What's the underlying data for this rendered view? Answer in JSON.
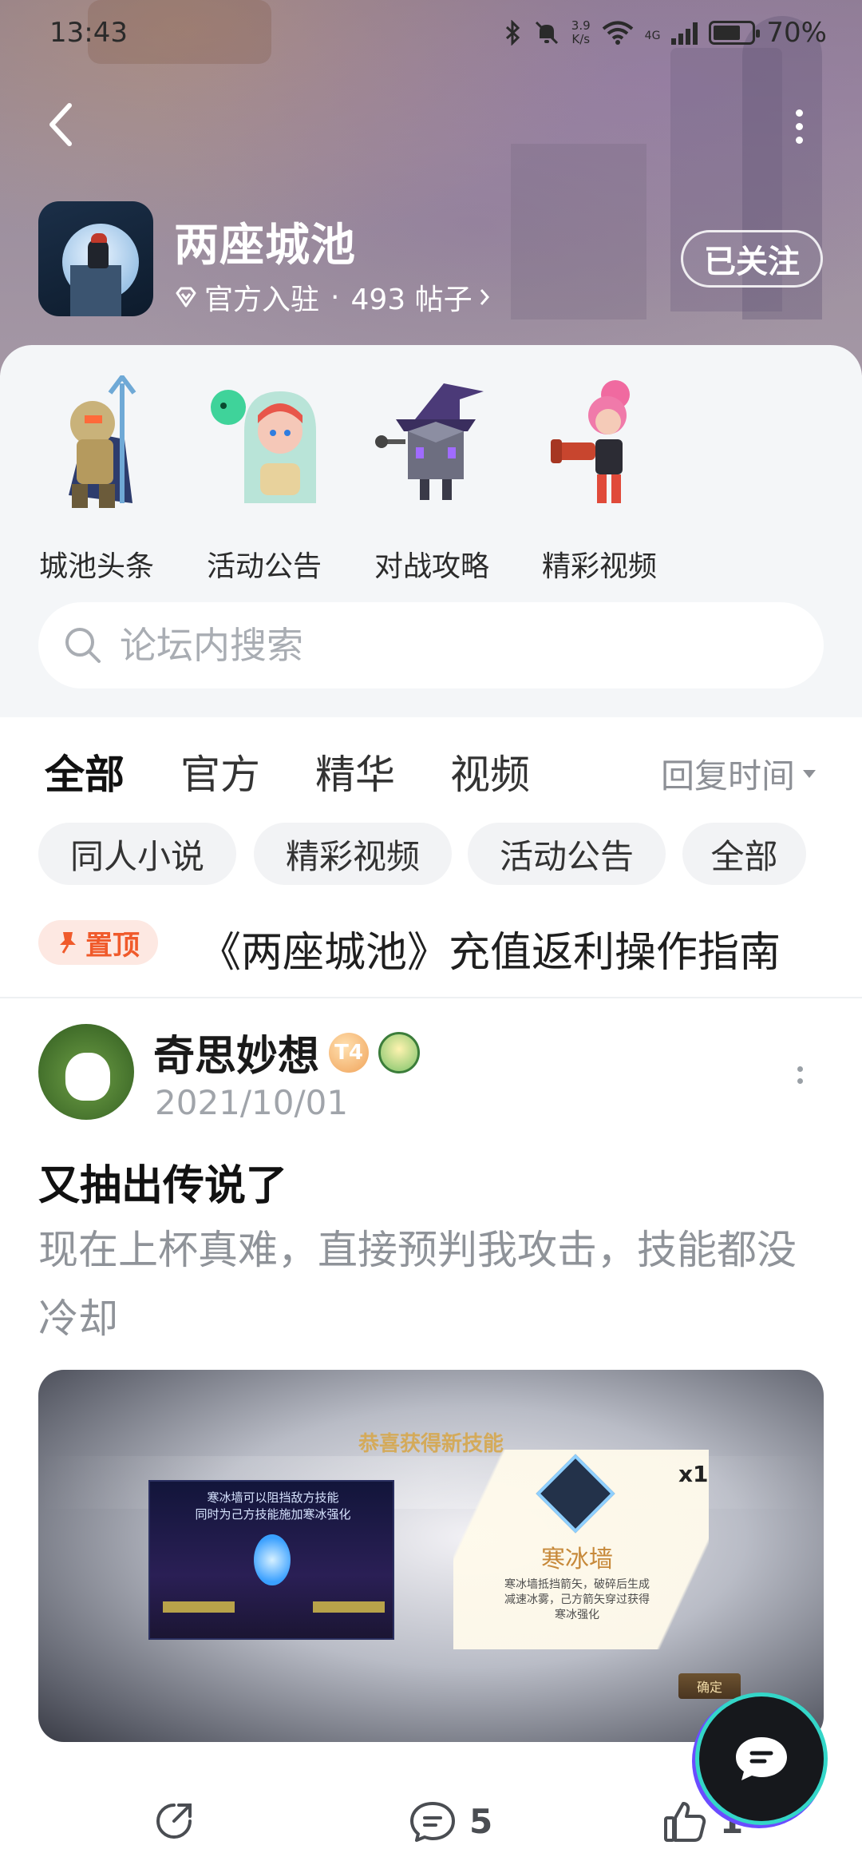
{
  "status_bar": {
    "time": "13:43",
    "net_speed_value": "3.9",
    "net_speed_unit": "K/s",
    "network_type": "4G",
    "battery": "70%",
    "battery_level": 0.7
  },
  "forum": {
    "title": "两座城池",
    "verified_label": "官方入驻",
    "separator": "·",
    "post_count": "493 帖子",
    "follow_label": "已关注"
  },
  "categories": [
    {
      "label": "城池头条",
      "icon": "knight-trident-icon"
    },
    {
      "label": "活动公告",
      "icon": "girl-with-ghost-icon"
    },
    {
      "label": "对战攻略",
      "icon": "witch-cube-icon"
    },
    {
      "label": "精彩视频",
      "icon": "pink-gunner-icon"
    }
  ],
  "search": {
    "placeholder": "论坛内搜索"
  },
  "tabs": {
    "items": [
      "全部",
      "官方",
      "精华",
      "视频"
    ],
    "active": "全部",
    "sort_label": "回复时间"
  },
  "chips": [
    "同人小说",
    "精彩视频",
    "活动公告",
    "全部"
  ],
  "pinned": {
    "badge": "置顶",
    "title": "《两座城池》充值返利操作指南"
  },
  "post": {
    "author": "奇思妙想",
    "level_badge": "T4",
    "date": "2021/10/01",
    "title": "又抽出传说了",
    "body": "现在上杯真难，直接预判我攻击，技能都没冷却",
    "image": {
      "header": "恭喜获得新技能",
      "scene_tip_1": "寒冰墙可以阻挡敌方技能",
      "scene_tip_2": "同时为己方技能施加寒冰强化",
      "skill_name": "寒冰墙",
      "skill_desc": "寒冰墙抵挡箭矢，破碎后生成减速冰雾，己方箭矢穿过获得寒冰强化",
      "count": "x1",
      "confirm": "确定"
    },
    "actions": {
      "comments": "5",
      "likes": "1"
    }
  },
  "colors": {
    "accent": "#34d6c8",
    "pin_red": "#f05a2b",
    "muted_text": "#8f9399"
  }
}
